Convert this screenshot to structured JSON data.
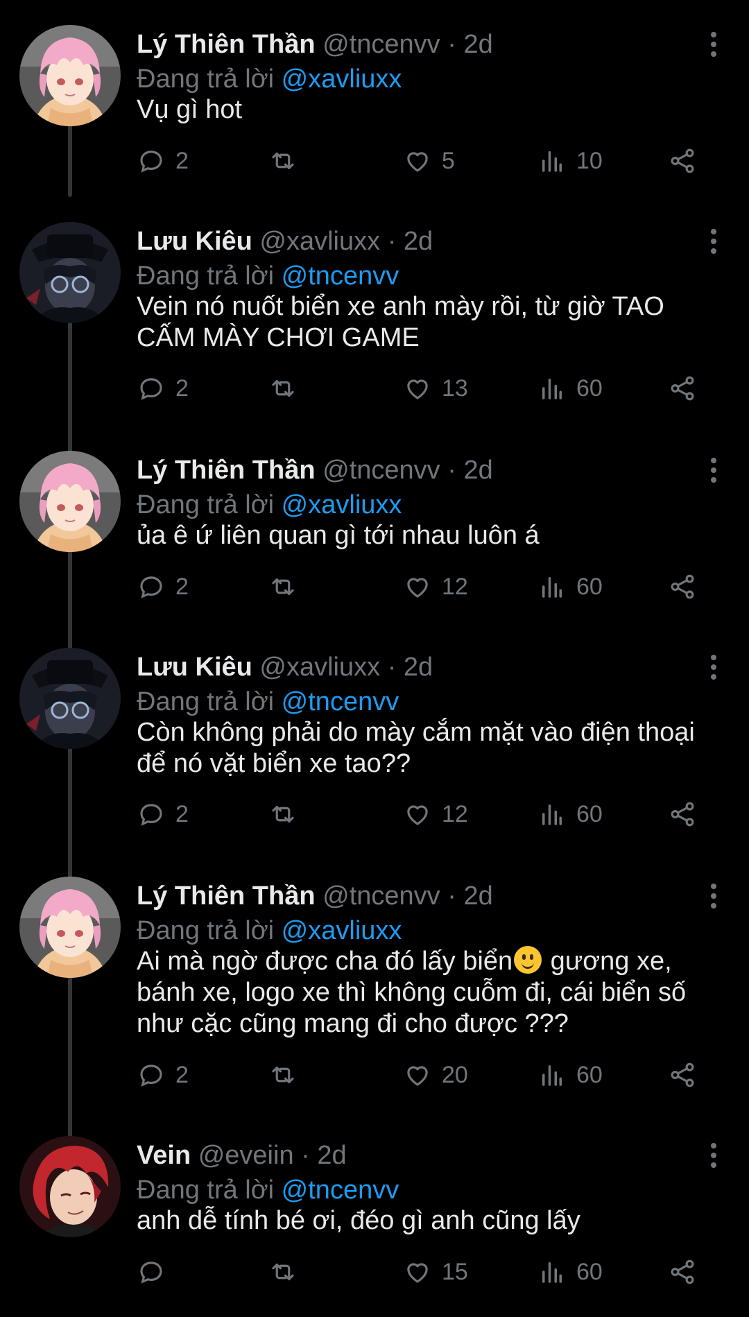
{
  "tweets": [
    {
      "name": "Lý Thiên Thần",
      "handle": "@tncenvv",
      "time": "2d",
      "reply_prefix": "Đang trả lời",
      "reply_to": "@xavliuxx",
      "lines": [
        "Vụ gì hot"
      ],
      "replies": "2",
      "likes": "5",
      "views": "10",
      "avatar": "pink-hair-boy-avatar"
    },
    {
      "name": "Lưu Kiêu",
      "handle": "@xavliuxx",
      "time": "2d",
      "reply_prefix": "Đang trả lời",
      "reply_to": "@tncenvv",
      "lines": [
        "Vein nó nuốt biển xe anh mày rồi, từ giờ TAO",
        "CẤM MÀY CHƠI GAME"
      ],
      "replies": "2",
      "likes": "13",
      "views": "60",
      "avatar": "dark-hat-glasses-avatar"
    },
    {
      "name": "Lý Thiên Thần",
      "handle": "@tncenvv",
      "time": "2d",
      "reply_prefix": "Đang trả lời",
      "reply_to": "@xavliuxx",
      "lines": [
        "ủa ê ứ liên quan gì tới nhau luôn á"
      ],
      "replies": "2",
      "likes": "12",
      "views": "60",
      "avatar": "pink-hair-boy-avatar"
    },
    {
      "name": "Lưu Kiêu",
      "handle": "@xavliuxx",
      "time": "2d",
      "reply_prefix": "Đang trả lời",
      "reply_to": "@tncenvv",
      "lines": [
        "Còn không phải do mày cắm mặt vào điện thoại",
        "để nó vặt biển xe tao??"
      ],
      "replies": "2",
      "likes": "12",
      "views": "60",
      "avatar": "dark-hat-glasses-avatar"
    },
    {
      "name": "Lý Thiên Thần",
      "handle": "@tncenvv",
      "time": "2d",
      "reply_prefix": "Đang trả lời",
      "reply_to": "@xavliuxx",
      "lines": [
        "Ai mà ngờ được cha đó lấy biển",
        "bánh xe, logo xe thì không cuỗm đi, cái biển số",
        "như cặc cũng mang đi cho được ???"
      ],
      "line1_after_emoji": " gương xe,",
      "replies": "2",
      "likes": "20",
      "views": "60",
      "avatar": "pink-hair-boy-avatar"
    },
    {
      "name": "Vein",
      "handle": "@eveiin",
      "time": "2d",
      "reply_prefix": "Đang trả lời",
      "reply_to": "@tncenvv",
      "lines": [
        "anh dễ tính bé ơi, đéo gì anh cũng lấy"
      ],
      "replies": "",
      "likes": "15",
      "views": "60",
      "avatar": "red-hair-man-avatar"
    }
  ],
  "colors": {
    "background": "#000000",
    "text": "#e7e9ea",
    "secondary": "#71767b",
    "link": "#1d9bf0",
    "thread_line": "#333639"
  },
  "icons": [
    "reply-icon",
    "retweet-icon",
    "like-icon",
    "views-icon",
    "share-icon",
    "more-icon"
  ]
}
